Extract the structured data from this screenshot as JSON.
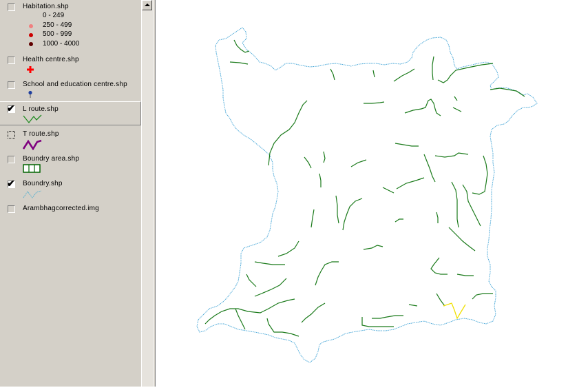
{
  "legend": {
    "layers": [
      {
        "name": "Habitation.shp",
        "checked": false,
        "classes": [
          {
            "label": "0 - 249",
            "color": "#d4d0c8"
          },
          {
            "label": "250 - 499",
            "color": "#f08080"
          },
          {
            "label": "500 - 999",
            "color": "#cc0000"
          },
          {
            "label": "1000 - 4000",
            "color": "#600000"
          }
        ]
      },
      {
        "name": "Health centre.shp",
        "checked": false,
        "symbol": "red-cross-icon",
        "color": "#ff0000"
      },
      {
        "name": "School and education centre.shp",
        "checked": false,
        "symbol": "pin-icon",
        "color": "#1f3f9f"
      },
      {
        "name": "L route.shp",
        "checked": true,
        "selected": true,
        "symbol": "line-icon",
        "color": "#228b22"
      },
      {
        "name": "T route.shp",
        "checked": false,
        "symbol": "line-icon",
        "color": "#7f007f"
      },
      {
        "name": "Boundry area.shp",
        "checked": false,
        "symbol": "fill-icon",
        "color": "#006400"
      },
      {
        "name": "Boundry.shp",
        "checked": true,
        "symbol": "line-icon",
        "color": "#5fb3cf"
      },
      {
        "name": "Arambhagcorrected.img",
        "checked": false
      }
    ]
  },
  "map": {
    "boundary_color": "#4aa8d8",
    "route_color": "#1a7a1a",
    "highlight_color": "#f0e000"
  }
}
